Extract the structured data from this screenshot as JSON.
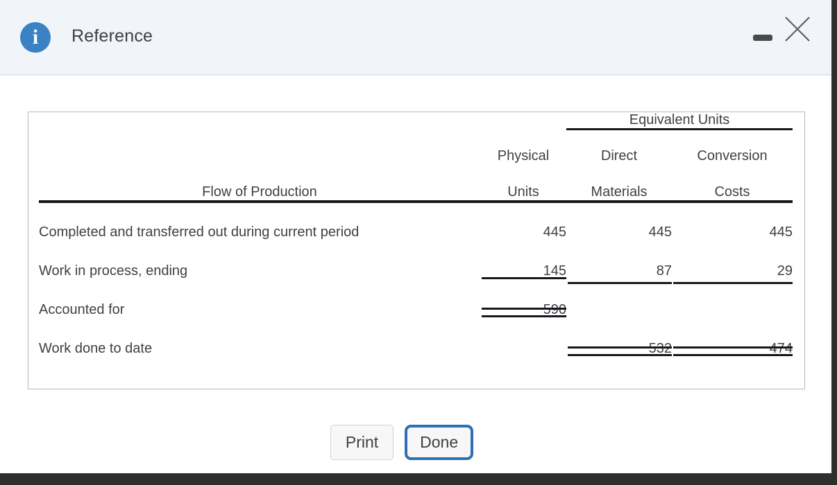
{
  "window": {
    "title": "Reference",
    "info_icon": "info-circle-icon",
    "minimize_label": "minimize-icon",
    "close_label": "close-icon"
  },
  "table": {
    "group_header": "Equivalent Units",
    "columns": {
      "flow": "Flow of Production",
      "physical_line1": "Physical",
      "physical_line2": "Units",
      "dm_line1": "Direct",
      "dm_line2": "Materials",
      "cc_line1": "Conversion",
      "cc_line2": "Costs"
    },
    "rows": [
      {
        "label": "Completed and transferred out during current period",
        "physical_units": "445",
        "direct_materials": "445",
        "conversion_costs": "445"
      },
      {
        "label": "Work in process, ending",
        "physical_units": "145",
        "direct_materials": "87",
        "conversion_costs": "29"
      },
      {
        "label": "Accounted for",
        "physical_units": "590",
        "direct_materials": "",
        "conversion_costs": ""
      },
      {
        "label": "Work done to date",
        "physical_units": "",
        "direct_materials": "532",
        "conversion_costs": "474"
      }
    ]
  },
  "footer": {
    "print_label": "Print",
    "done_label": "Done"
  },
  "colors": {
    "header_background": "#f1f5fa",
    "accent_blue": "#3b82c4",
    "focus_blue": "#2f6fb5",
    "text": "#3d4044",
    "rule": "#15171a",
    "box_border": "#b6b8ba",
    "page_backdrop": "#2e2e2e"
  }
}
